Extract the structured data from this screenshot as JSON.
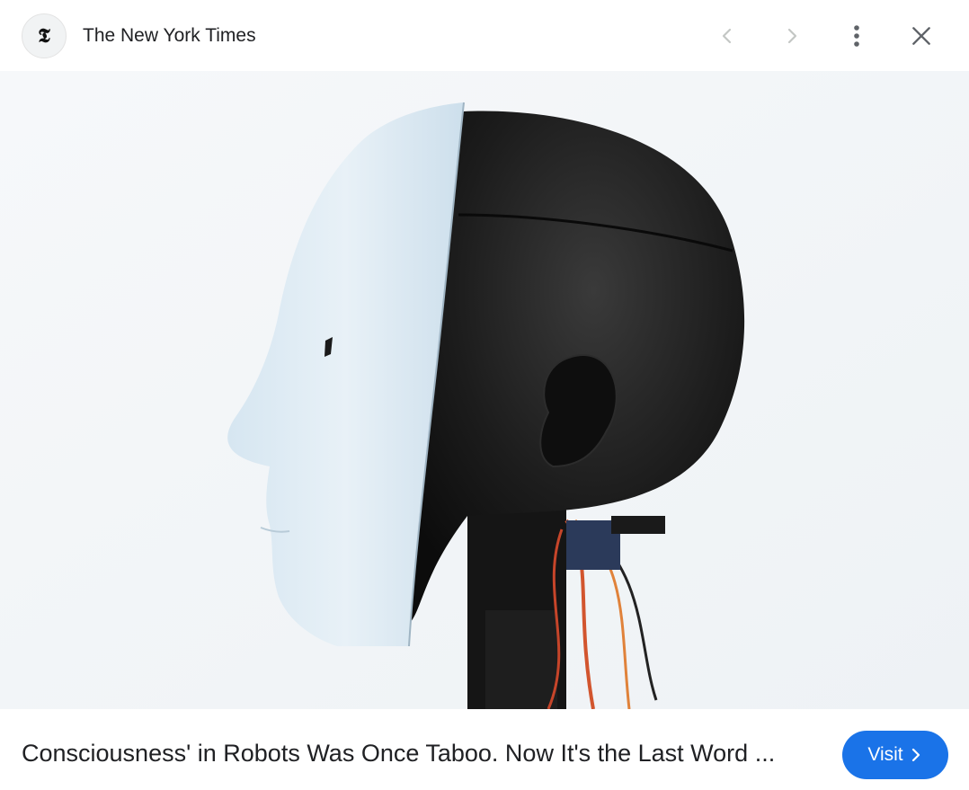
{
  "header": {
    "source_name": "The New York Times",
    "logo_glyph": "𝕿",
    "icons": [
      "chevron-left-icon",
      "chevron-right-icon",
      "more-vert-icon",
      "close-icon"
    ]
  },
  "image": {
    "subject": "robot-head-photo"
  },
  "footer": {
    "title": "Consciousness' in Robots Was Once Taboo. Now It's the Last Word ...",
    "visit_label": "Visit"
  },
  "colors": {
    "accent": "#1a73e8",
    "icon_disabled": "#c4c7c5",
    "icon_active": "#5f6368"
  }
}
